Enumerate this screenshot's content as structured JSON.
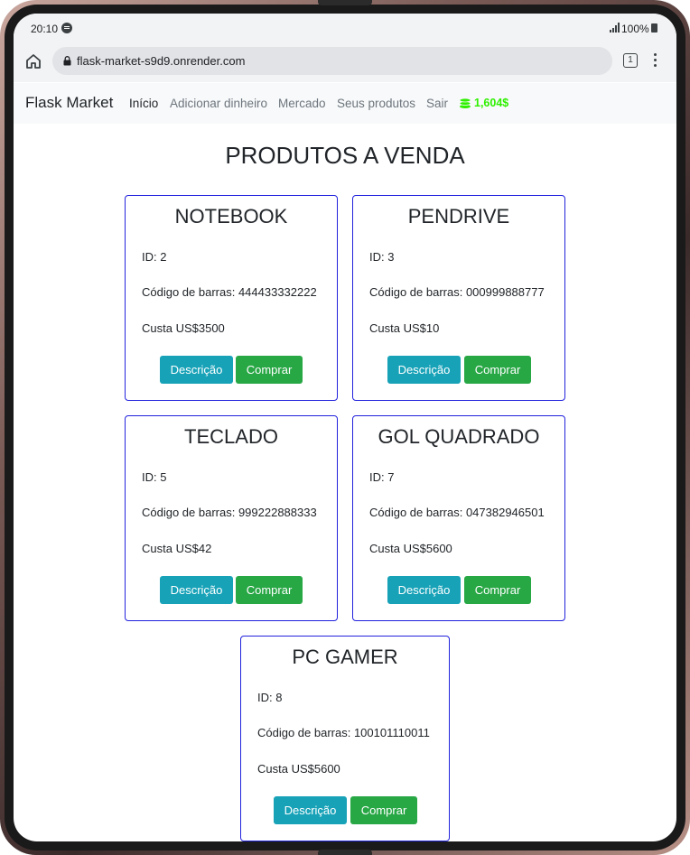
{
  "status_bar": {
    "time": "20:10",
    "battery": "100%"
  },
  "browser": {
    "url": "flask-market-s9d9.onrender.com",
    "tab_count": "1"
  },
  "navbar": {
    "brand": "Flask Market",
    "links": [
      "Início",
      "Adicionar dinheiro",
      "Mercado",
      "Seus produtos",
      "Sair"
    ],
    "active_link": "Início",
    "balance": "1,604$",
    "balance_color": "#2ef000"
  },
  "main": {
    "title": "PRODUTOS A VENDA",
    "description_label": "Descrição",
    "buy_label": "Comprar",
    "products": [
      {
        "name": "NOTEBOOK",
        "id": "ID: 2",
        "barcode": "Código de barras: 444433332222",
        "price": "Custa US$3500"
      },
      {
        "name": "PENDRIVE",
        "id": "ID: 3",
        "barcode": "Código de barras: 000999888777",
        "price": "Custa US$10"
      },
      {
        "name": "TECLADO",
        "id": "ID: 5",
        "barcode": "Código de barras: 999222888333",
        "price": "Custa US$42"
      },
      {
        "name": "GOL QUADRADO",
        "id": "ID: 7",
        "barcode": "Código de barras: 047382946501",
        "price": "Custa US$5600"
      },
      {
        "name": "PC GAMER",
        "id": "ID: 8",
        "barcode": "Código de barras: 100101110011",
        "price": "Custa US$5600"
      }
    ]
  },
  "colors": {
    "card_border": "#2222dd",
    "description_button": "#17a2b8",
    "buy_button": "#28a745"
  }
}
